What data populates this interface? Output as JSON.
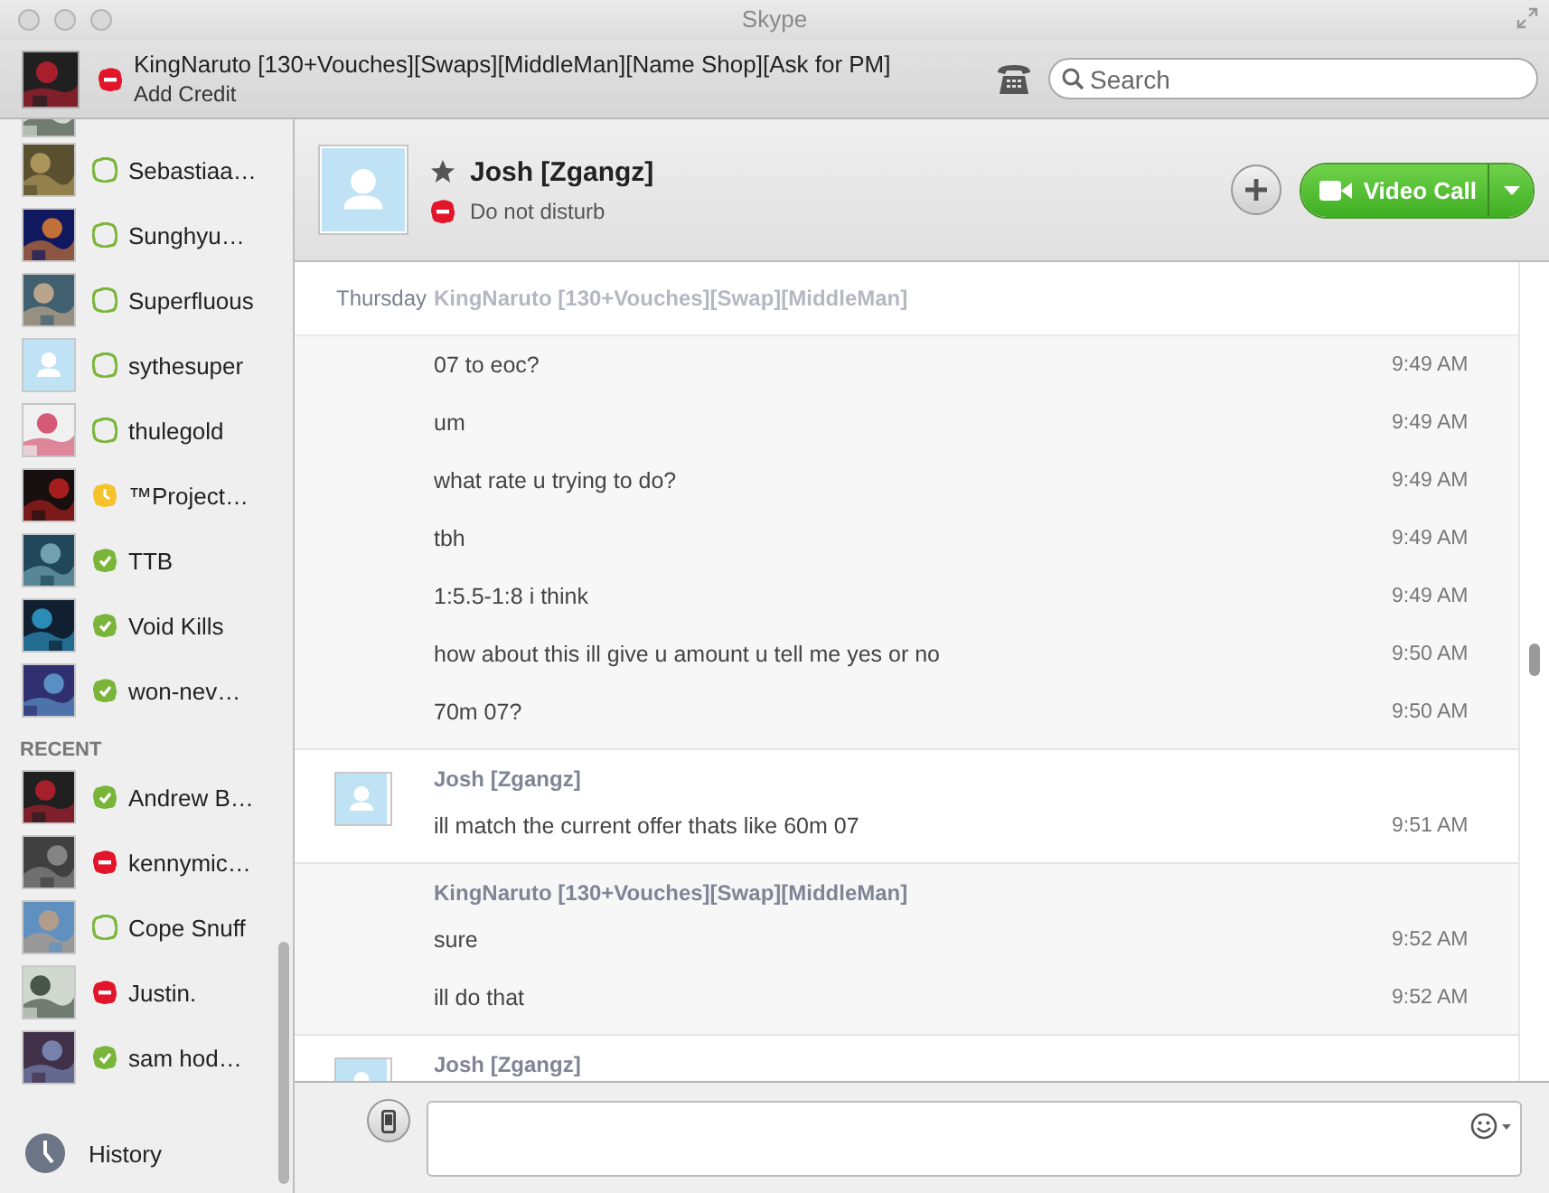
{
  "window": {
    "title": "Skype"
  },
  "account": {
    "name": "KingNaruto [130+Vouches][Swaps][MiddleMan][Name Shop][Ask for PM]",
    "status": {
      "kind": "dnd"
    },
    "link": "Add Credit"
  },
  "search": {
    "placeholder": "Search"
  },
  "sidebar": {
    "contacts": [
      {
        "name": "Sebastiaa…",
        "status": {
          "kind": "offline"
        },
        "photo": true
      },
      {
        "name": "Sunghyu…",
        "status": {
          "kind": "offline"
        },
        "photo": true
      },
      {
        "name": "Superfluous",
        "status": {
          "kind": "offline"
        },
        "photo": true
      },
      {
        "name": "sythesuper",
        "status": {
          "kind": "offline"
        },
        "photo": false
      },
      {
        "name": "thulegold",
        "status": {
          "kind": "offline"
        },
        "photo": true
      },
      {
        "name": "™Project…",
        "status": {
          "kind": "away"
        },
        "photo": true
      },
      {
        "name": "TTB",
        "status": {
          "kind": "online"
        },
        "photo": true
      },
      {
        "name": "Void Kills",
        "status": {
          "kind": "online"
        },
        "photo": true
      },
      {
        "name": "won-nev…",
        "status": {
          "kind": "online"
        },
        "photo": true
      }
    ],
    "recent_heading": "RECENT",
    "recent": [
      {
        "name": "Andrew B…",
        "status": {
          "kind": "online"
        },
        "photo": true
      },
      {
        "name": "kennymic…",
        "status": {
          "kind": "dnd"
        },
        "photo": true
      },
      {
        "name": "Cope Snuff",
        "status": {
          "kind": "offline"
        },
        "photo": true
      },
      {
        "name": "Justin.",
        "status": {
          "kind": "dnd"
        },
        "photo": true
      },
      {
        "name": "sam hod…",
        "status": {
          "kind": "online"
        },
        "photo": true
      }
    ],
    "history": "History"
  },
  "conversation": {
    "name": "Josh [Zgangz]",
    "status": {
      "kind": "dnd"
    },
    "status_text": "Do not disturb",
    "video_call": "Video Call"
  },
  "chat": {
    "date": "Thursday",
    "groups": [
      {
        "sender": "KingNaruto [130+Vouches][Swap][MiddleMan]",
        "self": true,
        "faded": true,
        "messages": [
          {
            "text": "07 to eoc?",
            "time": "9:49 AM"
          },
          {
            "text": "um",
            "time": "9:49 AM"
          },
          {
            "text": "what rate u trying to do?",
            "time": "9:49 AM"
          },
          {
            "text": "tbh",
            "time": "9:49 AM"
          },
          {
            "text": "1:5.5-1:8 i think",
            "time": "9:49 AM"
          },
          {
            "text": "how about this ill give u amount u tell me yes or no",
            "time": "9:50 AM"
          },
          {
            "text": "70m 07?",
            "time": "9:50 AM"
          }
        ]
      },
      {
        "sender": "Josh [Zgangz]",
        "self": false,
        "faded": false,
        "messages": [
          {
            "text": "ill match the current offer thats like 60m 07",
            "time": "9:51 AM"
          }
        ]
      },
      {
        "sender": "KingNaruto [130+Vouches][Swap][MiddleMan]",
        "self": true,
        "faded": false,
        "messages": [
          {
            "text": "sure",
            "time": "9:52 AM"
          },
          {
            "text": "ill do that",
            "time": "9:52 AM"
          }
        ]
      },
      {
        "sender": "Josh [Zgangz]",
        "self": false,
        "faded": false
      }
    ]
  }
}
